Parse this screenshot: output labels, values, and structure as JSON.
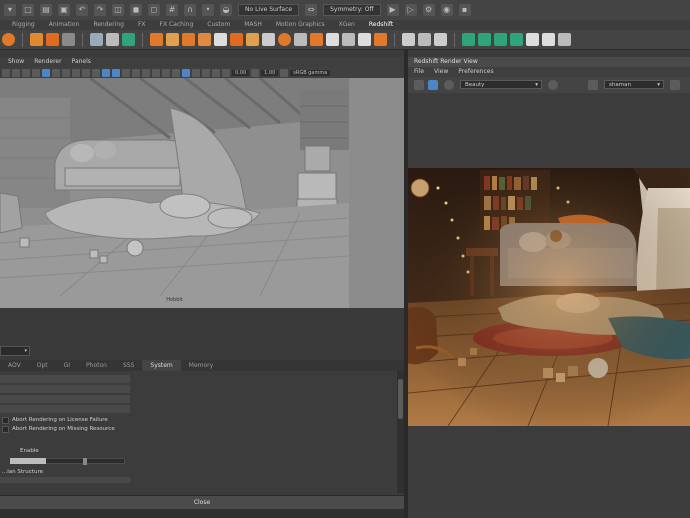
{
  "status_line": {
    "surface_field": "No Live Surface",
    "symmetry_field": "Symmetry: Off"
  },
  "shelf_tabs": [
    "Rigging",
    "Animation",
    "Rendering",
    "FX",
    "FX Caching",
    "Custom",
    "MASH",
    "Motion Graphics",
    "XGen",
    "Redshift"
  ],
  "viewport": {
    "menu": [
      "Show",
      "Renderer",
      "Panels"
    ],
    "toolbar_value_1": "0.00",
    "toolbar_value_2": "1.00",
    "colorspace": "sRGB gamma",
    "camera_label": "Hobbit"
  },
  "render_settings": {
    "tabs": [
      "AOV",
      "Opt",
      "GI",
      "Photon",
      "SSS",
      "System",
      "Memory"
    ],
    "active_tab": "System",
    "options": [
      "Abort Rendering on License Failure",
      "Abort Rendering on Missing Resource"
    ],
    "enable_label": "Enable",
    "section_label": "...lan Structure",
    "close_label": "Close"
  },
  "render_view": {
    "title": "Redshift Render View",
    "menu": [
      "File",
      "View",
      "Preferences"
    ],
    "camera_dropdown": "Beauty",
    "aov_dropdown": "shaman"
  },
  "colors": {
    "ui_bg": "#3b3b3b",
    "accent_blue": "#4a86c8",
    "viewport_grey": "#9a9a9a",
    "shelf_orange": "#e07a2a",
    "shelf_teal": "#2fa37a"
  }
}
